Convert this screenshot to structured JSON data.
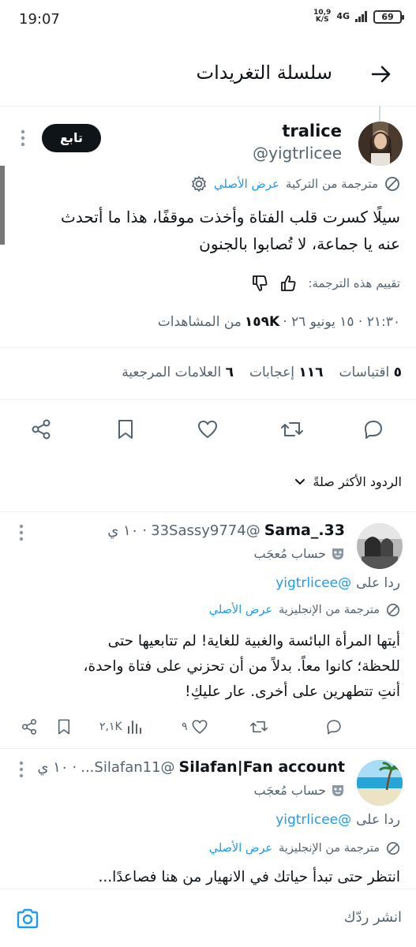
{
  "status_bar": {
    "time": "19:07",
    "net_speed_value": "10,9",
    "net_speed_unit": "K/S",
    "network": "4G",
    "battery": "69"
  },
  "header": {
    "title": "سلسلة التغريدات"
  },
  "main_tweet": {
    "name": "tralice",
    "handle": "@yigtrlicee",
    "follow_label": "تابع",
    "translated_from": "مترجمة من التركية",
    "show_original": "عرض الأصلي",
    "text_line1": "سيلًا كسرت قلب الفتاة وأخذت موقفًا، هذا ما أتحدث",
    "text_line2": "عنه يا جماعة، لا تُصابوا بالجنون",
    "rate_translation": "تقييم هذه الترجمة:",
    "timestamp": "٢١:٣٠ · ١٥ يونيو ٢٦ ·",
    "views_count": "١٥٩K",
    "views_label": "من المشاهدات",
    "stats": {
      "quotes_count": "٥",
      "quotes_label": "اقتباسات",
      "likes_count": "١١٦",
      "likes_label": "إعجابات",
      "bookmarks_count": "٦",
      "bookmarks_label": "العلامات المرجعية"
    }
  },
  "replies_sort": {
    "label": "الردود الأكثر صلةً"
  },
  "replies": [
    {
      "name": "Sama_.33",
      "handle": "@33Sassy9774",
      "time": "١٠ ي",
      "badge": "حساب مُعجَب",
      "replying_to_prefix": "ردا على",
      "replying_to_handle": "@yigtrlicee",
      "translated_from": "مترجمة من الإنجليزية",
      "show_original": "عرض الأصلي",
      "text_line1": "أيتها المرأة البائسة والغبية للغاية! لم تتابعيها حتى",
      "text_line2": "للحظة؛ كانوا معاً. بدلاً من أن تحزني على فتاة واحدة،",
      "text_line3": "أنتِ تتطهرين على أخرى. عار عليكِ!",
      "likes": "٩",
      "views": "٢,١K"
    },
    {
      "name": "Silafan|Fan account",
      "handle": "@Silafan11...",
      "time": "١٠ ي",
      "badge": "حساب مُعجَب",
      "replying_to_prefix": "ردا على",
      "replying_to_handle": "@yigtrlicee",
      "translated_from": "مترجمة من الإنجليزية",
      "show_original": "عرض الأصلي",
      "text_line1": "انتظر حتى تبدأ حياتك في الانهيار من هنا فصاعدًا..."
    }
  ],
  "composer": {
    "placeholder": "انشر ردّك"
  },
  "colors": {
    "accent": "#1d9bf0",
    "text": "#0f1419",
    "muted": "#536471",
    "divider": "#eff3f4"
  }
}
